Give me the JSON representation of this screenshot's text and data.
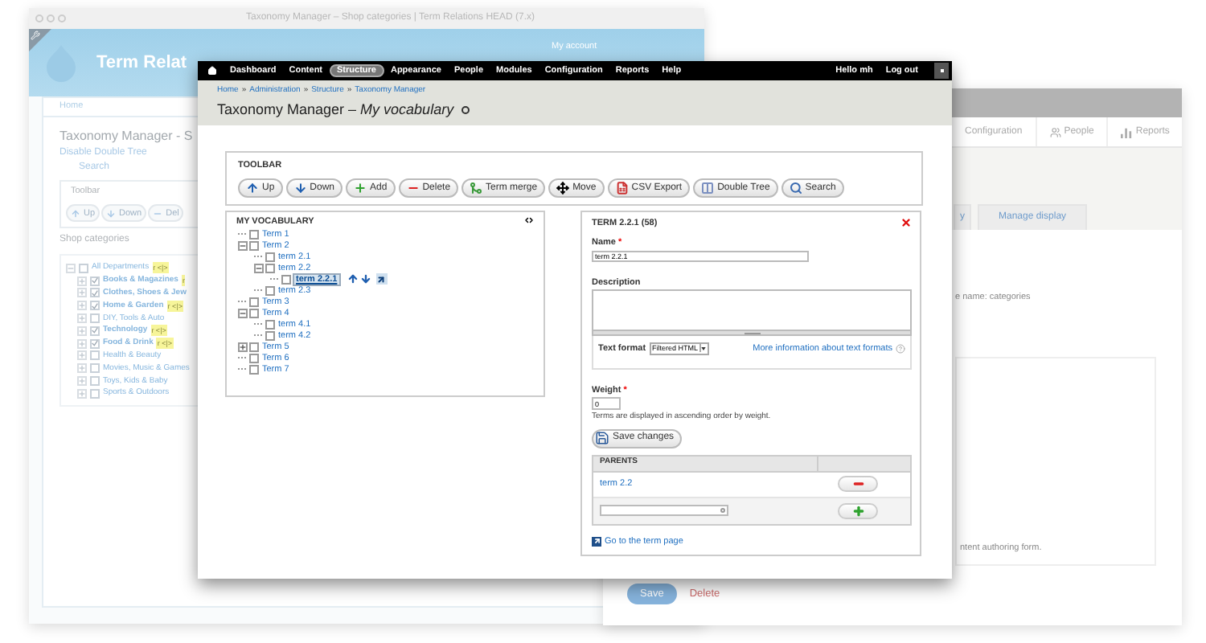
{
  "back_window": {
    "title": "Taxonomy Manager – Shop categories | Term Relations HEAD (7.x)",
    "site_name": "Term Relat",
    "user_link": "My account",
    "breadcrumb": "Home",
    "page_title": "Taxonomy Manager - S",
    "links": [
      "Disable Double Tree",
      "Search"
    ],
    "toolbar": {
      "legend": "Toolbar",
      "buttons": [
        {
          "kind": "up",
          "label": "Up"
        },
        {
          "kind": "down",
          "label": "Down"
        },
        {
          "kind": "delete",
          "label": "Del"
        }
      ]
    },
    "tree": {
      "legend": "Shop categories",
      "items": [
        {
          "label": "All Departments",
          "badge": "r <|>",
          "checked": false,
          "expanded": true,
          "children": [
            {
              "label": "Books & Magazines",
              "badge": "r",
              "checked": true,
              "expanded": false
            },
            {
              "label": "Clothes, Shoes & Jew",
              "checked": true,
              "expanded": false
            },
            {
              "label": "Home & Garden",
              "badge": "r <|>",
              "checked": true,
              "expanded": false
            },
            {
              "label": "DIY, Tools & Auto",
              "checked": false,
              "expanded": false
            },
            {
              "label": "Technology",
              "badge": "r <|>",
              "checked": true,
              "expanded": false
            },
            {
              "label": "Food & Drink",
              "badge": "r <|>",
              "checked": true,
              "expanded": false
            },
            {
              "label": "Health & Beauty",
              "checked": false,
              "expanded": false
            },
            {
              "label": "Movies, Music & Games",
              "checked": false,
              "expanded": false
            },
            {
              "label": "Toys, Kids & Baby",
              "checked": false,
              "expanded": false
            },
            {
              "label": "Sports & Outdoors",
              "checked": false,
              "expanded": false
            }
          ]
        }
      ]
    }
  },
  "right_window": {
    "nav": [
      {
        "kind": "wrench",
        "label": "Configuration"
      },
      {
        "kind": "people",
        "label": "People"
      },
      {
        "kind": "reports",
        "label": "Reports"
      }
    ],
    "tabs": [
      {
        "label": "y",
        "selected": false
      },
      {
        "label": "Manage display",
        "selected": false
      }
    ],
    "machine_name": "e name: categories",
    "box_text": "ntent authoring form.",
    "buttons": [
      {
        "kind": "primary",
        "label": "Save"
      },
      {
        "kind": "danger",
        "label": "Delete"
      }
    ]
  },
  "main_window": {
    "nav": [
      {
        "label": "Dashboard",
        "selected": false
      },
      {
        "label": "Content",
        "selected": false
      },
      {
        "label": "Structure",
        "selected": true
      },
      {
        "label": "Appearance",
        "selected": false
      },
      {
        "label": "People",
        "selected": false
      },
      {
        "label": "Modules",
        "selected": false
      },
      {
        "label": "Configuration",
        "selected": false
      },
      {
        "label": "Reports",
        "selected": false
      },
      {
        "label": "Help",
        "selected": false
      }
    ],
    "user": [
      "Hello mh",
      "Log out"
    ],
    "breadcrumb": [
      "Home",
      "Administration",
      "Structure",
      "Taxonomy Manager"
    ],
    "breadcrumb_separator": "»",
    "title": "Taxonomy Manager – *My vocabulary*",
    "toolbar": {
      "legend": "TOOLBAR",
      "buttons": [
        {
          "kind": "up",
          "label": "Up"
        },
        {
          "kind": "down",
          "label": "Down"
        },
        {
          "kind": "add",
          "label": "Add"
        },
        {
          "kind": "delete",
          "label": "Delete"
        },
        {
          "kind": "merge",
          "label": "Term merge"
        },
        {
          "kind": "move",
          "label": "Move"
        },
        {
          "kind": "csv",
          "label": "CSV Export"
        },
        {
          "kind": "double",
          "label": "Double Tree"
        },
        {
          "kind": "search",
          "label": "Search"
        }
      ]
    },
    "tree": {
      "title": "MY VOCABULARY",
      "items": [
        {
          "label": "Term 1",
          "checked": false,
          "selected": false
        },
        {
          "label": "Term 2",
          "checked": false,
          "selected": false,
          "expanded": true,
          "children": [
            {
              "label": "term 2.1",
              "checked": false,
              "selected": false
            },
            {
              "label": "term 2.2",
              "checked": false,
              "selected": false,
              "expanded": true,
              "children": [
                {
                  "label": "term 2.2.1",
                  "checked": false,
                  "selected": true
                }
              ]
            },
            {
              "label": "term 2.3",
              "checked": false,
              "selected": false
            }
          ]
        },
        {
          "label": "Term 3",
          "checked": false,
          "selected": false
        },
        {
          "label": "Term 4",
          "checked": false,
          "selected": false,
          "expanded": true,
          "children": [
            {
              "label": "term 4.1",
              "checked": false,
              "selected": false
            },
            {
              "label": "term 4.2",
              "checked": false,
              "selected": false
            }
          ]
        },
        {
          "label": "Term 5",
          "checked": false,
          "selected": false,
          "expanded": false
        },
        {
          "label": "Term 6",
          "checked": false,
          "selected": false
        },
        {
          "label": "Term 7",
          "checked": false,
          "selected": false
        }
      ]
    },
    "term": {
      "heading": "TERM 2.2.1 (58)",
      "name_label": "Name",
      "name_value": "term 2.2.1",
      "required_mark": "*",
      "description_label": "Description",
      "format_label": "Text format",
      "format_value": "Filtered HTML",
      "format_link": "More information about text formats",
      "weight_label": "Weight",
      "weight_value": "0",
      "weight_help": "Terms are displayed in ascending order by weight.",
      "save_label": "Save changes",
      "parents": {
        "heading": "PARENTS",
        "rows": [
          {
            "kind": "term",
            "label": "term 2.2"
          },
          {
            "kind": "input"
          }
        ]
      },
      "page_link": "Go to the term page"
    }
  }
}
